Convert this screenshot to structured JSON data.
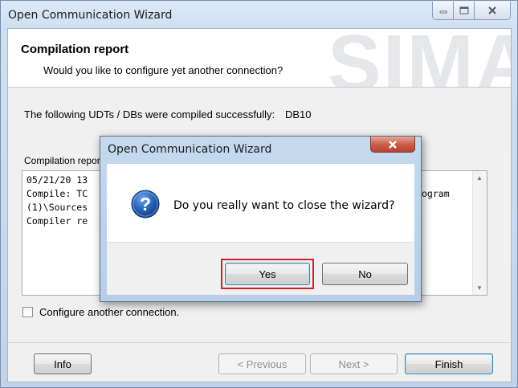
{
  "window": {
    "title": "Open Communication Wizard"
  },
  "header": {
    "title": "Compilation report",
    "subtitle": "Would you like to configure yet another connection?",
    "watermark": "SIMA"
  },
  "udt": {
    "label": "The following UDTs / DBs were compiled successfully:",
    "value": "DB10"
  },
  "compilation": {
    "label": "Compilation report",
    "lines": [
      "05/21/20 13",
      "Compile: TC",
      "(1)\\Sources",
      "Compiler re"
    ],
    "line_tail": "ogram"
  },
  "options": {
    "configure_another_label": "Configure another connection.",
    "configure_another_checked": false
  },
  "buttons": {
    "info": "Info",
    "previous": "< Previous",
    "next": "Next >",
    "finish": "Finish"
  },
  "dialog": {
    "title": "Open Communication Wizard",
    "message": "Do you really want to close the wizard?",
    "icon": "question-icon",
    "yes": "Yes",
    "no": "No",
    "highlight_color": "#d0202c"
  }
}
